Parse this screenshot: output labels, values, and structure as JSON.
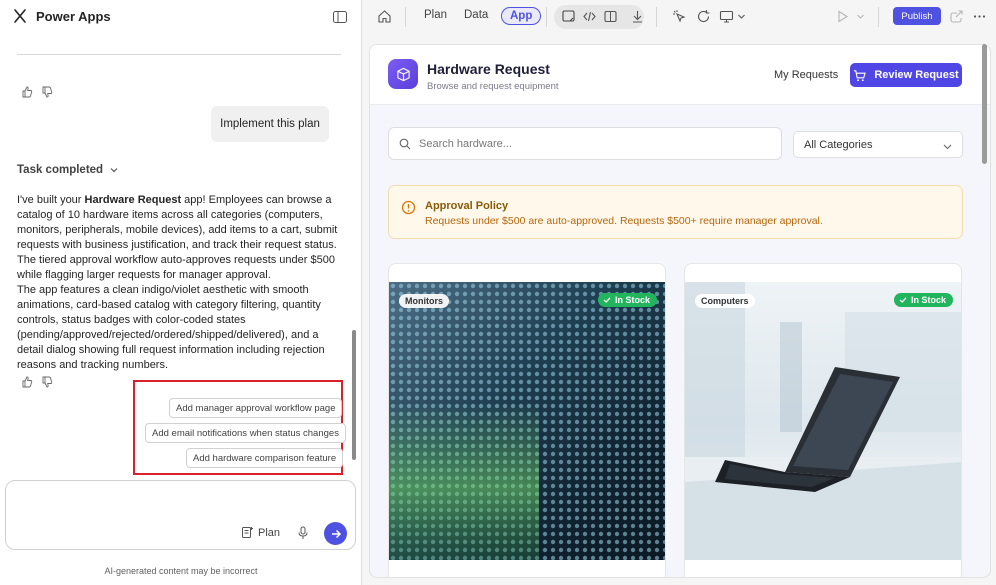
{
  "brand": {
    "name": "Power Apps"
  },
  "chat": {
    "user_message": "Implement this plan",
    "task_status": "Task completed",
    "response": {
      "intro": "I've built your ",
      "app_name": "Hardware Request",
      "body1": " app! Employees can browse a catalog of 10 hardware items across all categories (computers, monitors, peripherals, mobile devices), add items to a cart, submit requests with business justification, and track their request status. The tiered approval workflow auto-approves requests under $500 while flagging larger requests for manager approval.",
      "body2": "The app features a clean indigo/violet aesthetic with smooth animations, card-based catalog with category filtering, quantity controls, status badges with color-coded states (pending/approved/rejected/ordered/shipped/delivered), and a detail dialog showing full request information including rejection reasons and tracking numbers."
    },
    "suggestions": [
      "Add manager approval workflow page",
      "Add email notifications when status changes",
      "Add hardware comparison feature"
    ],
    "composer": {
      "plan_label": "Plan"
    },
    "disclaimer": "AI-generated content may be incorrect"
  },
  "toolbar": {
    "tabs": [
      "Plan",
      "Data",
      "App"
    ],
    "active_tab": "App",
    "publish_label": "Publish"
  },
  "app": {
    "title": "Hardware Request",
    "subtitle": "Browse and request equipment",
    "my_requests": "My Requests",
    "review_request": "Review Request",
    "search_placeholder": "Search hardware...",
    "category_selected": "All Categories",
    "policy": {
      "title": "Approval Policy",
      "text": "Requests under $500 are auto-approved. Requests $500+ require manager approval."
    },
    "cards": [
      {
        "category": "Monitors",
        "stock": "In Stock"
      },
      {
        "category": "Computers",
        "stock": "In Stock"
      }
    ]
  },
  "colors": {
    "accent": "#4f46e5",
    "in_stock": "#22b55e",
    "policy_bg": "#fff8eb",
    "highlight_box": "#d9202b"
  }
}
